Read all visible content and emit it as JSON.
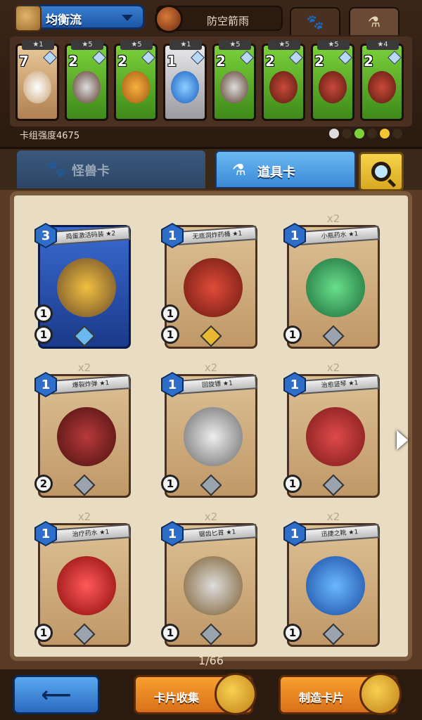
{
  "deck": {
    "name": "均衡流",
    "hero_name": "防空箭雨",
    "strength_label": "卡组强度4675",
    "cards": [
      {
        "count": "7",
        "rarity": "★1",
        "color": "tan"
      },
      {
        "count": "2",
        "rarity": "★5",
        "color": "green"
      },
      {
        "count": "2",
        "rarity": "★5",
        "color": "green"
      },
      {
        "count": "1",
        "rarity": "★1",
        "color": "silver"
      },
      {
        "count": "2",
        "rarity": "★5",
        "color": "green"
      },
      {
        "count": "2",
        "rarity": "★5",
        "color": "green"
      },
      {
        "count": "2",
        "rarity": "★5",
        "color": "green"
      },
      {
        "count": "2",
        "rarity": "★4",
        "color": "green"
      }
    ]
  },
  "tabs": {
    "monster": "怪兽卡",
    "item": "道具卡"
  },
  "grid": {
    "cards": [
      {
        "dup": "",
        "cost": "3",
        "title": "捣蛋激活码装 ★2",
        "atk": "1",
        "hp": "1",
        "tier": "blue"
      },
      {
        "dup": "",
        "cost": "1",
        "title": "无底洞炸药桶 ★1",
        "atk": "1",
        "hp": "1",
        "tier": "gold"
      },
      {
        "dup": "x2",
        "cost": "1",
        "title": "小瓶药水 ★1",
        "atk": "",
        "hp": "1",
        "tier": "silver"
      },
      {
        "dup": "x2",
        "cost": "1",
        "title": "爆裂炸弹 ★1",
        "atk": "",
        "hp": "2",
        "tier": "silver"
      },
      {
        "dup": "x2",
        "cost": "1",
        "title": "回旋镖 ★1",
        "atk": "",
        "hp": "1",
        "tier": "silver"
      },
      {
        "dup": "x2",
        "cost": "1",
        "title": "治愈竖琴 ★1",
        "atk": "",
        "hp": "1",
        "tier": "silver"
      },
      {
        "dup": "x2",
        "cost": "1",
        "title": "治疗药水 ★1",
        "atk": "",
        "hp": "1",
        "tier": "silver"
      },
      {
        "dup": "x2",
        "cost": "1",
        "title": "锯齿匕首 ★1",
        "atk": "",
        "hp": "1",
        "tier": "silver"
      },
      {
        "dup": "x2",
        "cost": "1",
        "title": "迅捷之靴 ★1",
        "atk": "",
        "hp": "1",
        "tier": "silver"
      }
    ],
    "page_count": "1/66"
  },
  "buttons": {
    "back": "⟵",
    "collect": "卡片收集",
    "craft": "制造卡片"
  },
  "colors": {
    "accent_blue": "#3a8ad8",
    "accent_orange": "#f8a030",
    "card_green": "#7ad13a"
  }
}
